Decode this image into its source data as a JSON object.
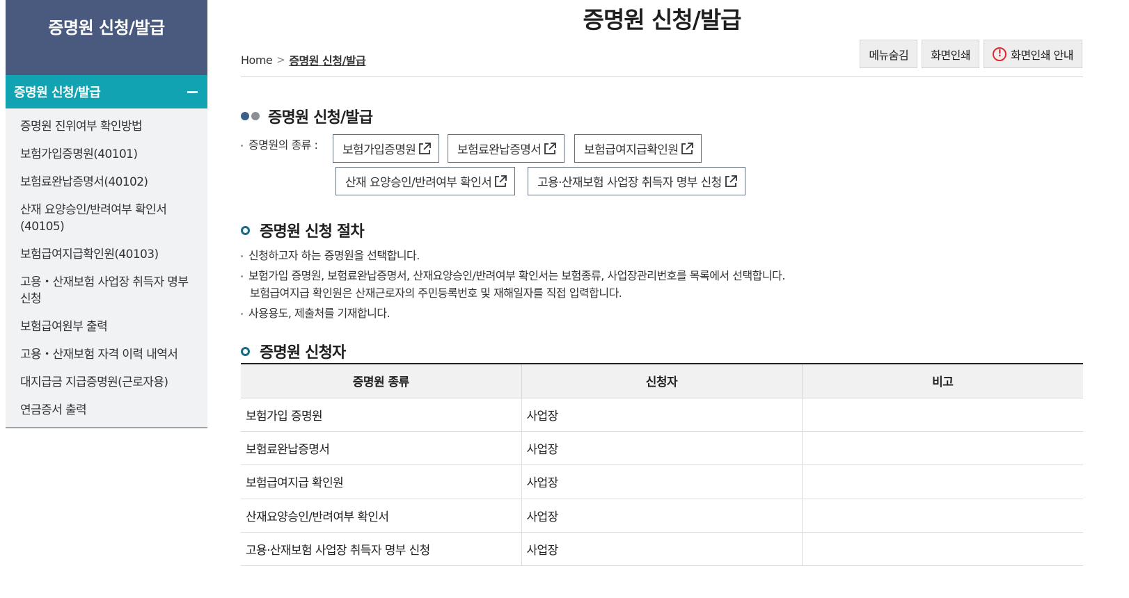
{
  "sidebar": {
    "title": "증명원 신청/발급",
    "active": "증명원 신청/발급",
    "items": [
      "증명원 진위여부 확인방법",
      "보험가입증명원(40101)",
      "보험료완납증명서(40102)",
      "산재 요양승인/반려여부 확인서 (40105)",
      "보험급여지급확인원(40103)",
      "고용・산재보험 사업장 취득자 명부 신청",
      "보험급여원부 출력",
      "고용・산재보험 자격 이력 내역서",
      "대지급금 지급증명원(근로자용)",
      "연금증서 출력"
    ]
  },
  "header": {
    "title": "증명원 신청/발급",
    "breadcrumb": {
      "home": "Home",
      "current": "증명원 신청/발급"
    },
    "buttons": {
      "hide_menu": "메뉴숨김",
      "print": "화면인쇄",
      "print_guide": "화면인쇄 안내"
    }
  },
  "section1": {
    "title": "증명원 신청/발급",
    "kind_label": "증명원의 종류 :",
    "certs": [
      "보험가입증명원",
      "보험료완납증명서",
      "보험급여지급확인원",
      "산재 요양승인/반려여부 확인서",
      "고용·산재보험 사업장 취득자 명부 신청"
    ]
  },
  "section2": {
    "title": "증명원 신청 절차",
    "lines": [
      "신청하고자 하는 증명원을 선택합니다.",
      "보험가입 증명원, 보험료완납증명서, 산재요양승인/반려여부 확인서는 보험종류, 사업장관리번호를 목록에서 선택합니다.",
      "보험급여지급 확인원은 산재근로자의 주민등록번호 및 재해일자를 직접 입력합니다.",
      "사용용도, 제출처를 기재합니다."
    ]
  },
  "section3": {
    "title": "증명원 신청자",
    "columns": [
      "증명원 종류",
      "신청자",
      "비고"
    ],
    "rows": [
      [
        "보험가입 증명원",
        "사업장",
        ""
      ],
      [
        "보험료완납증명서",
        "사업장",
        ""
      ],
      [
        "보험급여지급 확인원",
        "사업장",
        ""
      ],
      [
        "산재요양승인/반려여부 확인서",
        "사업장",
        ""
      ],
      [
        "고용·산재보험 사업장 취득자 명부 신청",
        "사업장",
        ""
      ]
    ]
  },
  "colors": {
    "sidebar_header": "#4a5a7e",
    "sidebar_active": "#11a3b1",
    "accent_dot_1": "#3a5f88",
    "accent_dot_2": "#8a9096",
    "ring": "#1a6b86",
    "warning": "#e0282c"
  }
}
